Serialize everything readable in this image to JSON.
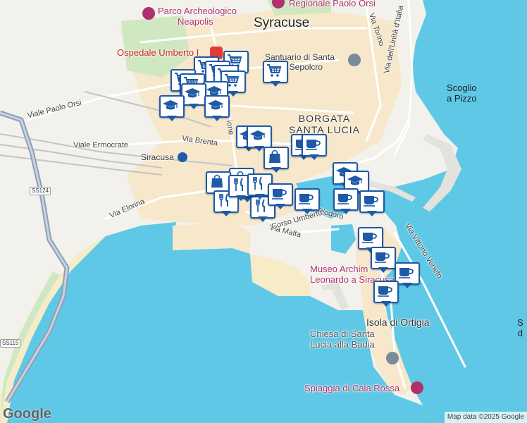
{
  "map": {
    "colors": {
      "water": "#5ec8e6",
      "land": "#f3f1ec",
      "city": "#f7e8cb",
      "park": "#cfe8c1",
      "road": "#ffffff",
      "rail": "#bdbdbd",
      "highway": "#8ea0b8",
      "pin_border": "#1e5aa8"
    },
    "labels": {
      "city": "Syracuse",
      "borgata": "BORGATA",
      "santa_lucia": "SANTA LUCIA",
      "isola": "Isola di Ortigia",
      "scoglio1": "Scoglio",
      "scoglio2": "a Pizzo",
      "siracusa_station": "Siracusa",
      "park1": "Parco Archeologico",
      "park2": "Neapolis",
      "hospital": "Ospedale Umberto I",
      "museum_top": "Regionale Paolo Orsi",
      "santuario1": "Santuario di Santa",
      "santuario2": "a al Sepolcro",
      "museo1": "Museo Archim",
      "museo2": "Leonardo a Siracusa",
      "chiesa1": "Chiesa di Santa",
      "chiesa2": "Lucia alla Badia",
      "spiaggia": "Spiaggia di Cala Rossa",
      "edge_s": "S",
      "edge_d": "d"
    },
    "roads": {
      "paolo_orsi": "Viale Paolo Orsi",
      "ermocrate": "Viale Ermocrate",
      "brenta": "Via Brenta",
      "elorina": "Via Elorina",
      "malta": "Via Malta",
      "umberto": "Corso Umberto I",
      "teodoro": "Via Teodoro",
      "torino": "Via Torino",
      "unita_italia": "Via dell'Unità d'Italia",
      "vittorio_veneto": "Via Vittorio Veneto",
      "montedoro_frag": "ione"
    },
    "shields": {
      "ss124": "SS124",
      "ss115": "SS115"
    },
    "attribution": "Map data ©2025 Google",
    "logo": "Google"
  },
  "markers": [
    {
      "icon": "shopping-cart"
    },
    {
      "icon": "shopping-cart"
    },
    {
      "icon": "shopping-cart"
    },
    {
      "icon": "shopping-cart"
    },
    {
      "icon": "shopping-cart"
    },
    {
      "icon": "shopping-cart"
    },
    {
      "icon": "shopping-cart"
    },
    {
      "icon": "shopping-cart"
    },
    {
      "icon": "graduation-cap"
    },
    {
      "icon": "graduation-cap"
    },
    {
      "icon": "graduation-cap"
    },
    {
      "icon": "graduation-cap"
    },
    {
      "icon": "graduation-cap"
    },
    {
      "icon": "graduation-cap"
    },
    {
      "icon": "graduation-cap"
    },
    {
      "icon": "graduation-cap"
    },
    {
      "icon": "shopping-bag"
    },
    {
      "icon": "shopping-bag"
    },
    {
      "icon": "shopping-bag"
    },
    {
      "icon": "fork-knife"
    },
    {
      "icon": "fork-knife"
    },
    {
      "icon": "fork-knife"
    },
    {
      "icon": "fork-knife"
    },
    {
      "icon": "fork-knife"
    },
    {
      "icon": "coffee-cup"
    },
    {
      "icon": "coffee-cup"
    },
    {
      "icon": "coffee-cup"
    },
    {
      "icon": "coffee-cup"
    },
    {
      "icon": "coffee-cup"
    },
    {
      "icon": "coffee-cup"
    },
    {
      "icon": "coffee-cup"
    },
    {
      "icon": "coffee-cup"
    },
    {
      "icon": "coffee-cup"
    },
    {
      "icon": "coffee-cup"
    }
  ]
}
